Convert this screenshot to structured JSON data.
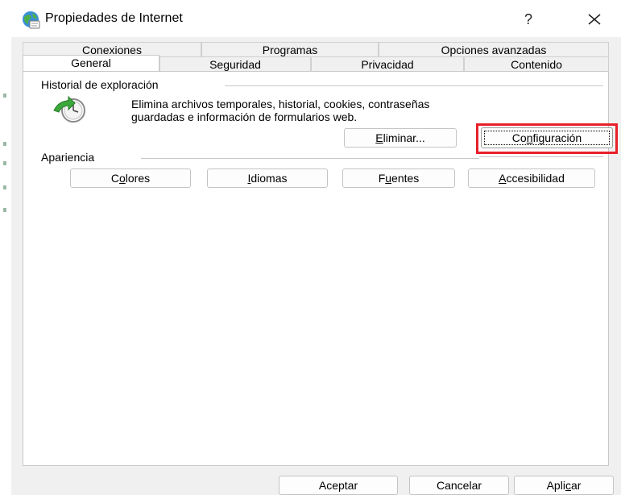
{
  "window": {
    "title": "Propiedades de Internet",
    "help_label": "?",
    "close_icon": "close-icon",
    "app_icon": "internet-globe-icon"
  },
  "tabs": {
    "row_back": [
      {
        "label": "Conexiones"
      },
      {
        "label": "Programas"
      },
      {
        "label": "Opciones avanzadas"
      }
    ],
    "row_front": [
      {
        "label": "General",
        "active": true
      },
      {
        "label": "Seguridad"
      },
      {
        "label": "Privacidad"
      },
      {
        "label": "Contenido"
      }
    ]
  },
  "history": {
    "group_label": "Historial de exploración",
    "icon": "history-clock-icon",
    "description_line1": "Elimina archivos temporales, historial, cookies, contraseñas",
    "description_line2": "guardadas e información de formularios web.",
    "delete_button": {
      "pre": "",
      "key": "E",
      "post": "liminar..."
    },
    "settings_button": {
      "pre": "Co",
      "key": "n",
      "post": "figuración"
    }
  },
  "appearance": {
    "group_label": "Apariencia",
    "colors_button": {
      "pre": "C",
      "key": "o",
      "post": "lores"
    },
    "languages_button": {
      "pre": "",
      "key": "I",
      "post": "diomas"
    },
    "fonts_button": {
      "pre": "F",
      "key": "u",
      "post": "entes"
    },
    "accessibility_button": {
      "pre": "",
      "key": "A",
      "post": "ccesibilidad"
    }
  },
  "footer": {
    "ok_label": "Aceptar",
    "cancel_label": "Cancelar",
    "apply_button": {
      "pre": "Apli",
      "key": "c",
      "post": "ar"
    }
  },
  "colors": {
    "highlight": "#e8202a",
    "panel_bg": "#ffffff",
    "dialog_bg": "#f0f0f0"
  }
}
